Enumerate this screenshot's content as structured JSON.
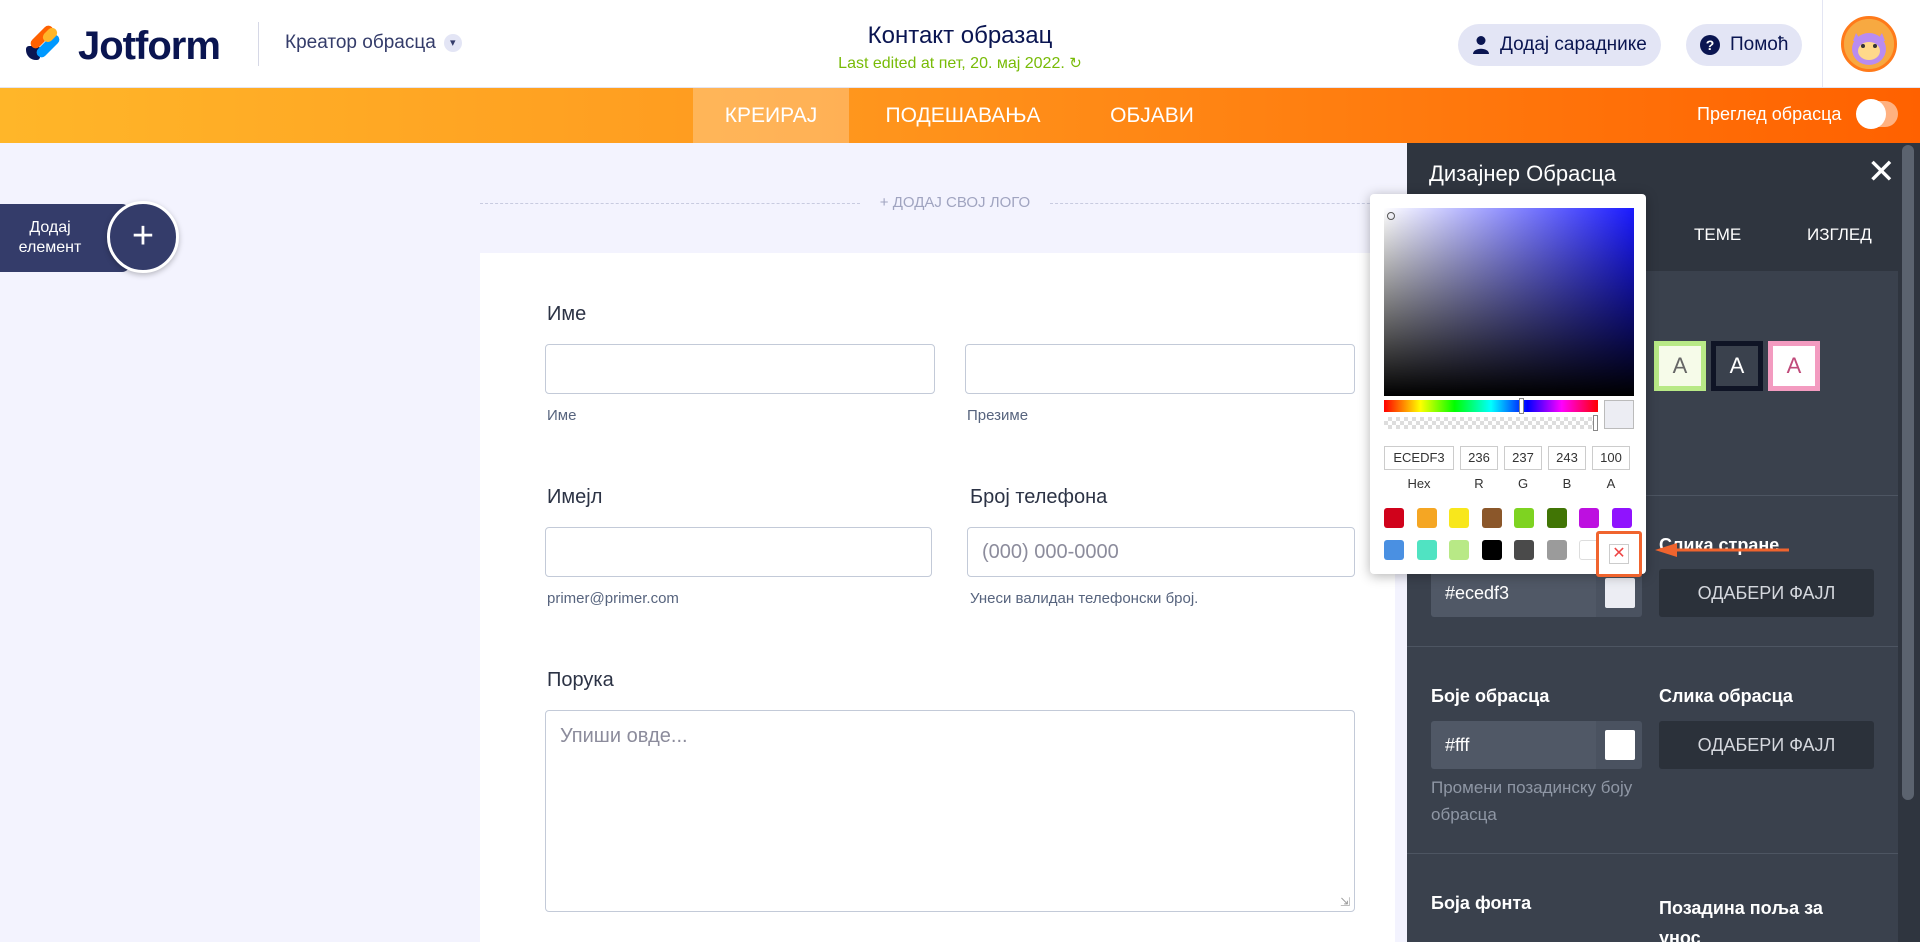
{
  "app": {
    "brand": "Jotform",
    "mode_label": "Креатор обрасца",
    "title": "Контакт образац",
    "last_edited": "Last edited at пет, 20. мај 2022."
  },
  "header": {
    "add_collaborators": "Додај сараднике",
    "help": "Помоћ"
  },
  "nav": {
    "tabs": [
      {
        "label": "КРЕИРАЈ",
        "active": true
      },
      {
        "label": "ПОДЕШАВАЊА",
        "active": false
      },
      {
        "label": "ОБЈАВИ",
        "active": false
      }
    ],
    "preview_label": "Преглед обрасца",
    "preview_on": false
  },
  "builder": {
    "add_element": "Додај елемент",
    "add_logo": "+ ДОДАЈ СВОЈ ЛОГО"
  },
  "form": {
    "name_label": "Име",
    "first_sub": "Име",
    "last_sub": "Презиме",
    "email_label": "Имејл",
    "email_sub": "primer@primer.com",
    "phone_label": "Број телефона",
    "phone_placeholder": "(000) 000-0000",
    "phone_sub": "Унеси валидан телефонски број.",
    "message_label": "Порука",
    "message_placeholder": "Упиши овде..."
  },
  "designer": {
    "title": "Дизајнер Обрасца",
    "tabs": [
      "ТЕМЕ",
      "ИЗГЛЕД"
    ],
    "theme_letter": "A",
    "page_image_label": "Слика стране",
    "page_color_value": "#ecedf3",
    "choose_file": "ОДАБЕРИ ФАЈЛ",
    "form_colors_label": "Боје обрасца",
    "form_color_value": "#fff",
    "form_image_label": "Слика обрасца",
    "form_color_help": "Промени позадинску боју обрасца",
    "font_color_label": "Боја фонта",
    "input_bg_label": "Позадина поља за унос"
  },
  "picker": {
    "hex": "ECEDF3",
    "r": "236",
    "g": "237",
    "b": "243",
    "a": "100",
    "labels": {
      "hex": "Hex",
      "r": "R",
      "g": "G",
      "b": "B",
      "a": "A"
    },
    "swatches_row1": [
      "#d0021b",
      "#f5a623",
      "#f8e71c",
      "#8b572a",
      "#7ed321",
      "#417505",
      "#bd10e0",
      "#9013fe"
    ],
    "swatches_row2": [
      "#4a90e2",
      "#50e3c2",
      "#b8e986",
      "#000000",
      "#4a4a4a",
      "#9b9b9b",
      "#ffffff"
    ]
  }
}
